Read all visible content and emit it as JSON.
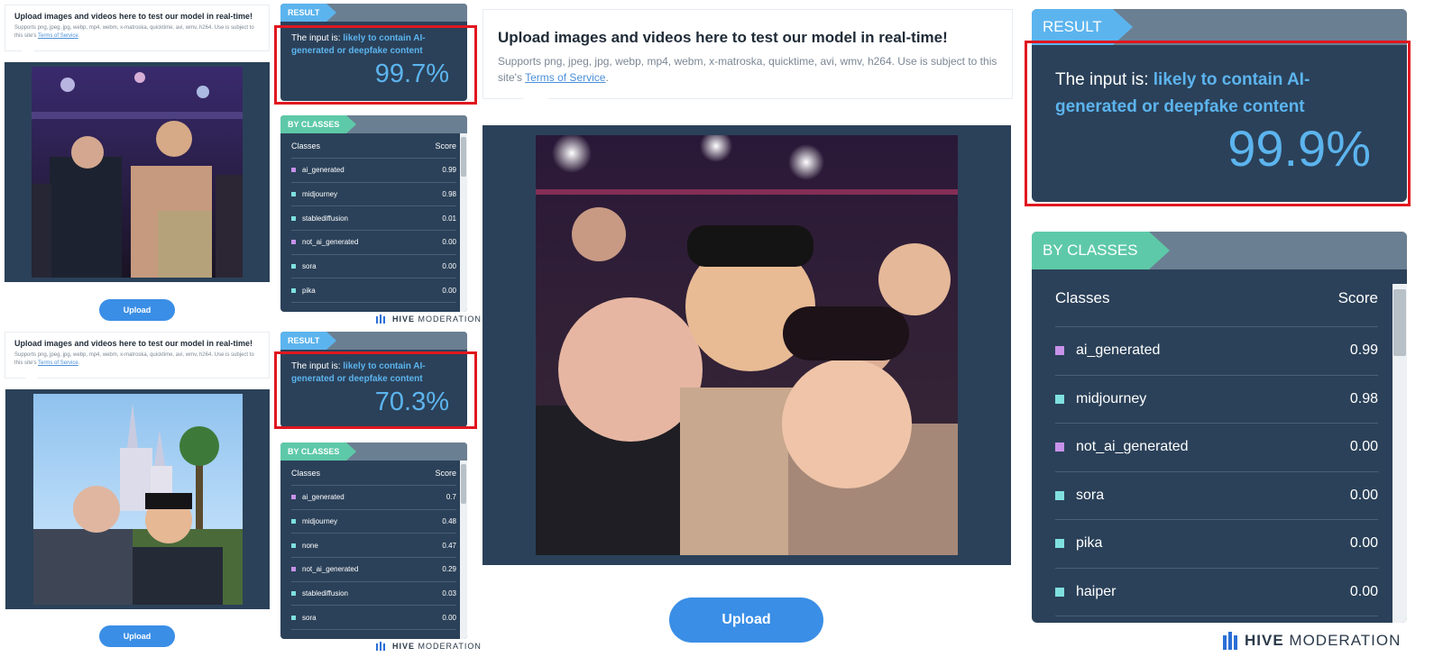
{
  "upload": {
    "title": "Upload images and videos here to test our model in real-time!",
    "desc_main": "Supports png, jpeg, jpg, webp, mp4, webm, x-matroska, quicktime, avi, wmv, h264. Use is subject to this site's ",
    "desc_small": "Supports png, jpeg, jpg, webp, mp4, webm, x-matroska, quicktime, avi, wmv, h264. Use is subject to this site's ",
    "tos": "Terms of Service",
    "period": ".",
    "button": "Upload"
  },
  "result": {
    "tag": "RESULT",
    "prefix": "The input is: ",
    "verdict": "likely to contain AI-generated or deepfake content"
  },
  "classes": {
    "tag": "BY CLASSES",
    "col_class": "Classes",
    "col_score": "Score"
  },
  "demo1": {
    "percent": "99.7%",
    "rows": [
      {
        "name": "ai_generated",
        "score": "0.99",
        "color": "purple"
      },
      {
        "name": "midjourney",
        "score": "0.98",
        "color": "teal"
      },
      {
        "name": "stablediffusion",
        "score": "0.01",
        "color": "teal"
      },
      {
        "name": "not_ai_generated",
        "score": "0.00",
        "color": "purple"
      },
      {
        "name": "sora",
        "score": "0.00",
        "color": "teal"
      },
      {
        "name": "pika",
        "score": "0.00",
        "color": "teal"
      }
    ]
  },
  "demo2": {
    "percent": "70.3%",
    "rows": [
      {
        "name": "ai_generated",
        "score": "0.7",
        "color": "purple"
      },
      {
        "name": "midjourney",
        "score": "0.48",
        "color": "teal"
      },
      {
        "name": "none",
        "score": "0.47",
        "color": "teal"
      },
      {
        "name": "not_ai_generated",
        "score": "0.29",
        "color": "purple"
      },
      {
        "name": "stablediffusion",
        "score": "0.03",
        "color": "teal"
      },
      {
        "name": "sora",
        "score": "0.00",
        "color": "teal"
      }
    ]
  },
  "demo3": {
    "percent": "99.9%",
    "rows": [
      {
        "name": "ai_generated",
        "score": "0.99",
        "color": "purple"
      },
      {
        "name": "midjourney",
        "score": "0.98",
        "color": "teal"
      },
      {
        "name": "not_ai_generated",
        "score": "0.00",
        "color": "purple"
      },
      {
        "name": "sora",
        "score": "0.00",
        "color": "teal"
      },
      {
        "name": "pika",
        "score": "0.00",
        "color": "teal"
      },
      {
        "name": "haiper",
        "score": "0.00",
        "color": "teal"
      }
    ]
  },
  "brand": {
    "hive": "HIVE",
    "moderation": "MODERATION"
  },
  "colors": {
    "accent": "#5cb4ee",
    "panel": "#2b4159",
    "classes_tag": "#5ec9a8",
    "highlight_box": "#e0171f",
    "upload_button": "#3a8ee6"
  }
}
